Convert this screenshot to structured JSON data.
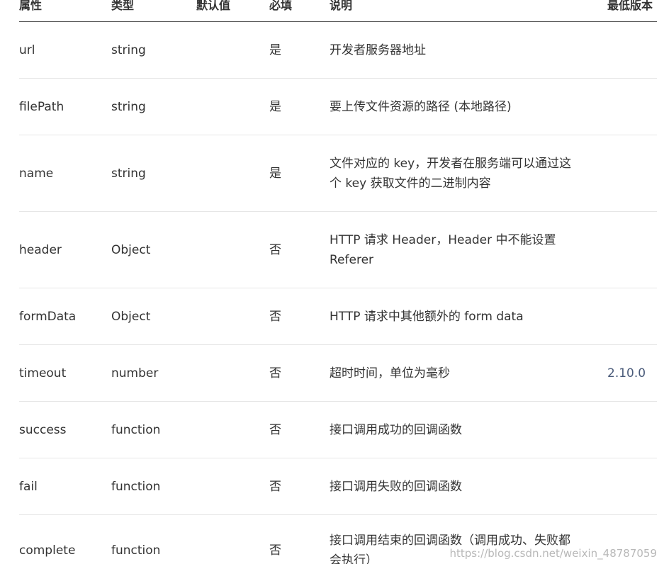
{
  "table": {
    "headers": {
      "attr": "属性",
      "type": "类型",
      "default": "默认值",
      "required": "必填",
      "desc": "说明",
      "version": "最低版本"
    },
    "rows": [
      {
        "attr": "url",
        "type": "string",
        "default": "",
        "required": "是",
        "desc": "开发者服务器地址",
        "version": ""
      },
      {
        "attr": "filePath",
        "type": "string",
        "default": "",
        "required": "是",
        "desc": "要上传文件资源的路径 (本地路径)",
        "version": ""
      },
      {
        "attr": "name",
        "type": "string",
        "default": "",
        "required": "是",
        "desc": "文件对应的 key，开发者在服务端可以通过这个 key 获取文件的二进制内容",
        "version": ""
      },
      {
        "attr": "header",
        "type": "Object",
        "default": "",
        "required": "否",
        "desc": "HTTP 请求 Header，Header 中不能设置 Referer",
        "version": ""
      },
      {
        "attr": "formData",
        "type": "Object",
        "default": "",
        "required": "否",
        "desc": "HTTP 请求中其他额外的 form data",
        "version": ""
      },
      {
        "attr": "timeout",
        "type": "number",
        "default": "",
        "required": "否",
        "desc": "超时时间，单位为毫秒",
        "version": "2.10.0"
      },
      {
        "attr": "success",
        "type": "function",
        "default": "",
        "required": "否",
        "desc": "接口调用成功的回调函数",
        "version": ""
      },
      {
        "attr": "fail",
        "type": "function",
        "default": "",
        "required": "否",
        "desc": "接口调用失败的回调函数",
        "version": ""
      },
      {
        "attr": "complete",
        "type": "function",
        "default": "",
        "required": "否",
        "desc": "接口调用结束的回调函数（调用成功、失败都会执行）",
        "version": ""
      }
    ]
  },
  "watermark": "https://blog.csdn.net/weixin_48787059",
  "colors": {
    "text": "#333333",
    "version_link": "#4a5b7a",
    "row_border": "#e6e6e6",
    "header_border": "#555555"
  }
}
